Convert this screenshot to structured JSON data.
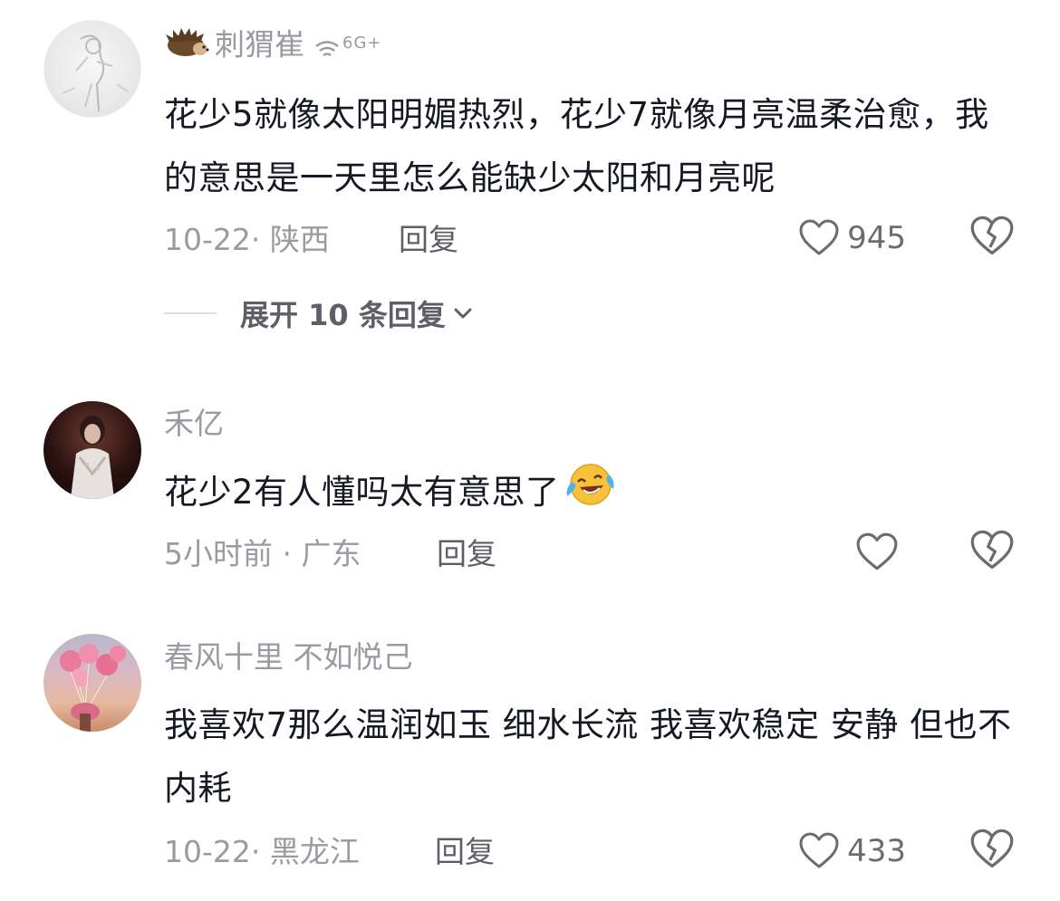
{
  "comments": [
    {
      "username": "刺猬崔",
      "signal_text": "6G+",
      "text": "花少5就像太阳明媚热烈，花少7就像月亮温柔治愈，我的意思是一天里怎么能缺少太阳和月亮呢",
      "meta": "10-22· 陕西",
      "reply_label": "回复",
      "likes": "945",
      "expand_label": "展开 10 条回复"
    },
    {
      "username": "禾亿",
      "text": "花少2有人懂吗太有意思了",
      "meta": "5小时前 · 广东",
      "reply_label": "回复",
      "likes": ""
    },
    {
      "username": "春风十里 不如悦己",
      "text": "我喜欢7那么温润如玉 细水长流 我喜欢稳定 安静 但也不内耗",
      "meta": "10-22· 黑龙江",
      "reply_label": "回复",
      "likes": "433"
    }
  ],
  "icons": {
    "badge": "hedgehog-icon",
    "signal": "wifi-signal-icon",
    "like": "heart-outline-icon",
    "dislike": "broken-heart-icon",
    "expand": "chevron-down-icon",
    "emoji": "laughing-tears-emoji-icon"
  },
  "colors": {
    "primary_text": "#161823",
    "secondary_text": "#9a9ba1",
    "action_text": "#5e5f66"
  }
}
